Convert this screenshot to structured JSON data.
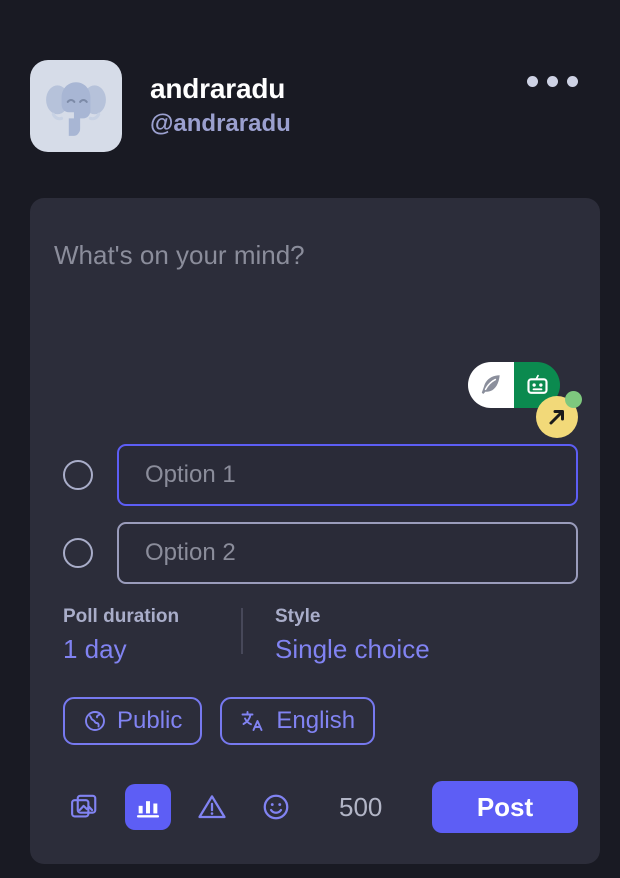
{
  "account": {
    "display_name": "andraradu",
    "handle": "@andraradu",
    "avatar_icon": "elephant-emoji",
    "more_icon": "ellipsis-icon"
  },
  "composer": {
    "placeholder": "What's on your mind?",
    "value": "",
    "assistant": {
      "quill_icon": "feather-quill-icon",
      "bot_icon": "robot-face-icon",
      "badge_icon": "arrow-up-right-icon",
      "status_dot": "online-dot",
      "white": "#ffffff",
      "green": "#0b8a4f",
      "yellow": "#f2d979",
      "dot_green": "#7ec87e"
    }
  },
  "poll": {
    "options": [
      {
        "placeholder": "Option 1",
        "value": "",
        "focused": true
      },
      {
        "placeholder": "Option 2",
        "value": "",
        "focused": false
      }
    ],
    "duration": {
      "label": "Poll duration",
      "value": "1 day"
    },
    "style": {
      "label": "Style",
      "value": "Single choice"
    }
  },
  "chips": [
    {
      "icon": "globe-icon",
      "label": "Public"
    },
    {
      "icon": "translate-icon",
      "label": "English"
    }
  ],
  "toolbar": {
    "buttons": [
      {
        "icon": "images-icon",
        "name": "add-images-button",
        "active": false
      },
      {
        "icon": "poll-icon",
        "name": "add-poll-button",
        "active": true
      },
      {
        "icon": "content-warning-icon",
        "name": "content-warning-button",
        "active": false
      },
      {
        "icon": "emoji-icon",
        "name": "emoji-picker-button",
        "active": false
      }
    ],
    "char_count": "500",
    "post_label": "Post"
  },
  "colors": {
    "page_bg": "#191a23",
    "card_bg": "#2c2d3a",
    "accent": "#5d5ef5",
    "accent_text": "#8183f2",
    "muted": "#8b8d9b"
  }
}
